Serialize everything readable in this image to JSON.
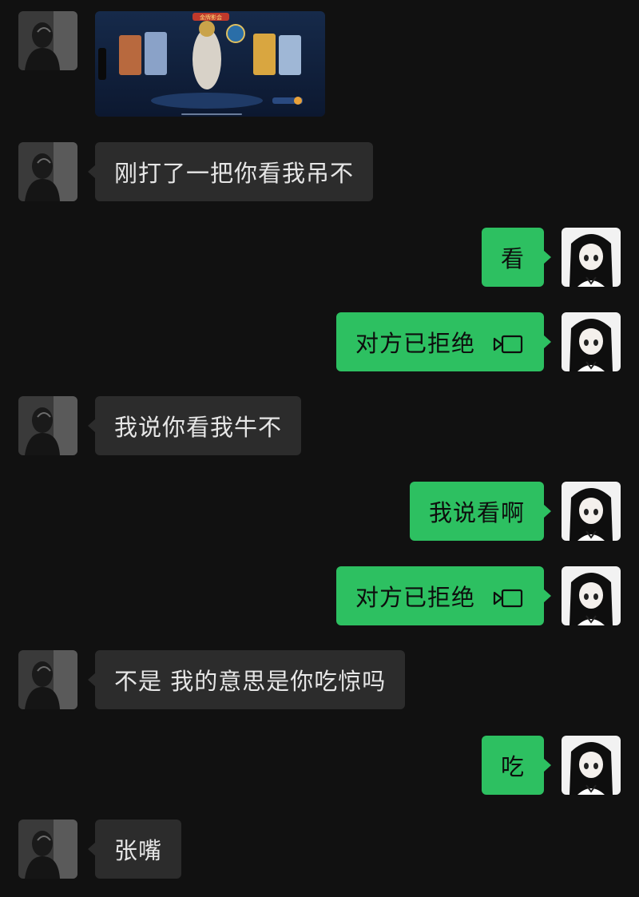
{
  "chat": {
    "image_message": {
      "game_banner": "金牌影会"
    },
    "messages": [
      {
        "side": "left",
        "text": "刚打了一把你看我吊不"
      },
      {
        "side": "right",
        "text": "看"
      },
      {
        "side": "right",
        "text": "对方已拒绝",
        "icon": "video-call-icon"
      },
      {
        "side": "left",
        "text": "我说你看我牛不"
      },
      {
        "side": "right",
        "text": "我说看啊"
      },
      {
        "side": "right",
        "text": "对方已拒绝",
        "icon": "video-call-icon"
      },
      {
        "side": "left",
        "text": "不是 我的意思是你吃惊吗"
      },
      {
        "side": "right",
        "text": "吃"
      },
      {
        "side": "left",
        "text": "张嘴"
      }
    ]
  },
  "colors": {
    "background": "#111111",
    "incoming_bubble": "#2c2c2c",
    "outgoing_bubble": "#2dc061"
  }
}
